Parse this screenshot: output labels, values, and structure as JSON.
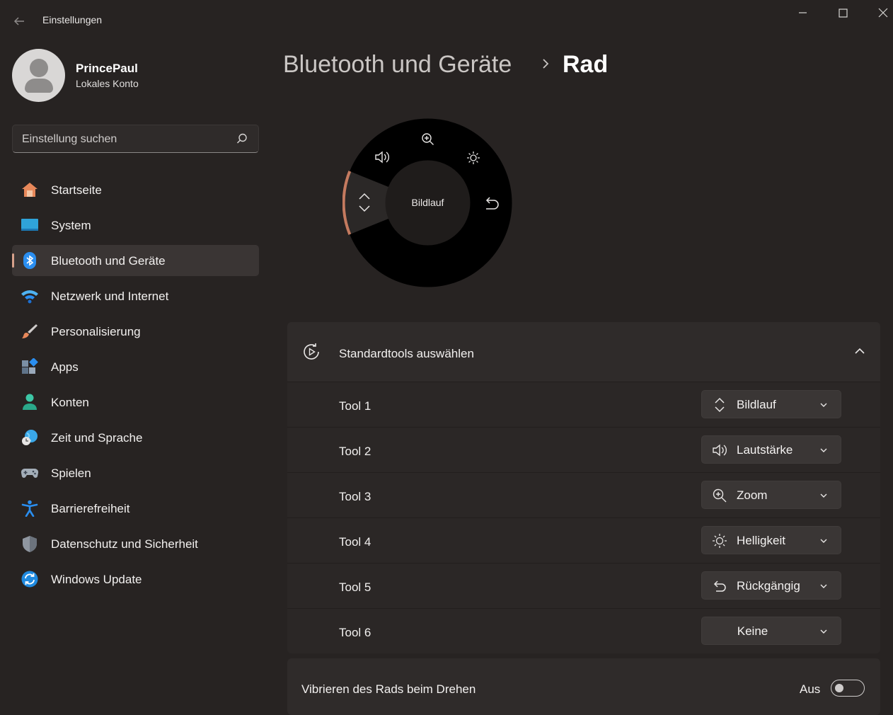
{
  "window": {
    "title": "Einstellungen",
    "controls": {
      "minimize": "—",
      "maximize": "☐",
      "close": "✕"
    }
  },
  "profile": {
    "name": "PrincePaul",
    "subtitle": "Lokales Konto"
  },
  "search": {
    "placeholder": "Einstellung suchen"
  },
  "sidebar": {
    "items": [
      {
        "label": "Startseite",
        "icon": "home-icon"
      },
      {
        "label": "System",
        "icon": "system-icon"
      },
      {
        "label": "Bluetooth und Geräte",
        "icon": "bluetooth-icon",
        "active": true
      },
      {
        "label": "Netzwerk und Internet",
        "icon": "wifi-icon"
      },
      {
        "label": "Personalisierung",
        "icon": "brush-icon"
      },
      {
        "label": "Apps",
        "icon": "apps-icon"
      },
      {
        "label": "Konten",
        "icon": "person-icon"
      },
      {
        "label": "Zeit und Sprache",
        "icon": "globe-clock-icon"
      },
      {
        "label": "Spielen",
        "icon": "gamepad-icon"
      },
      {
        "label": "Barrierefreiheit",
        "icon": "accessibility-icon"
      },
      {
        "label": "Datenschutz und Sicherheit",
        "icon": "shield-icon"
      },
      {
        "label": "Windows Update",
        "icon": "update-icon"
      }
    ]
  },
  "header": {
    "parent": "Bluetooth und Geräte",
    "separator": "›",
    "current": "Rad"
  },
  "wheel": {
    "center_label": "Bildlauf",
    "accent_color": "#c47a5f"
  },
  "section": {
    "title": "Standardtools auswählen",
    "tools": [
      {
        "label": "Tool 1",
        "value": "Bildlauf",
        "icon": "scroll-icon"
      },
      {
        "label": "Tool 2",
        "value": "Lautstärke",
        "icon": "volume-icon"
      },
      {
        "label": "Tool 3",
        "value": "Zoom",
        "icon": "zoom-icon"
      },
      {
        "label": "Tool 4",
        "value": "Helligkeit",
        "icon": "brightness-icon"
      },
      {
        "label": "Tool 5",
        "value": "Rückgängig",
        "icon": "undo-icon"
      },
      {
        "label": "Tool 6",
        "value": "Keine",
        "icon": ""
      }
    ]
  },
  "vibrate": {
    "label": "Vibrieren des Rads beim Drehen",
    "state": "Aus"
  }
}
